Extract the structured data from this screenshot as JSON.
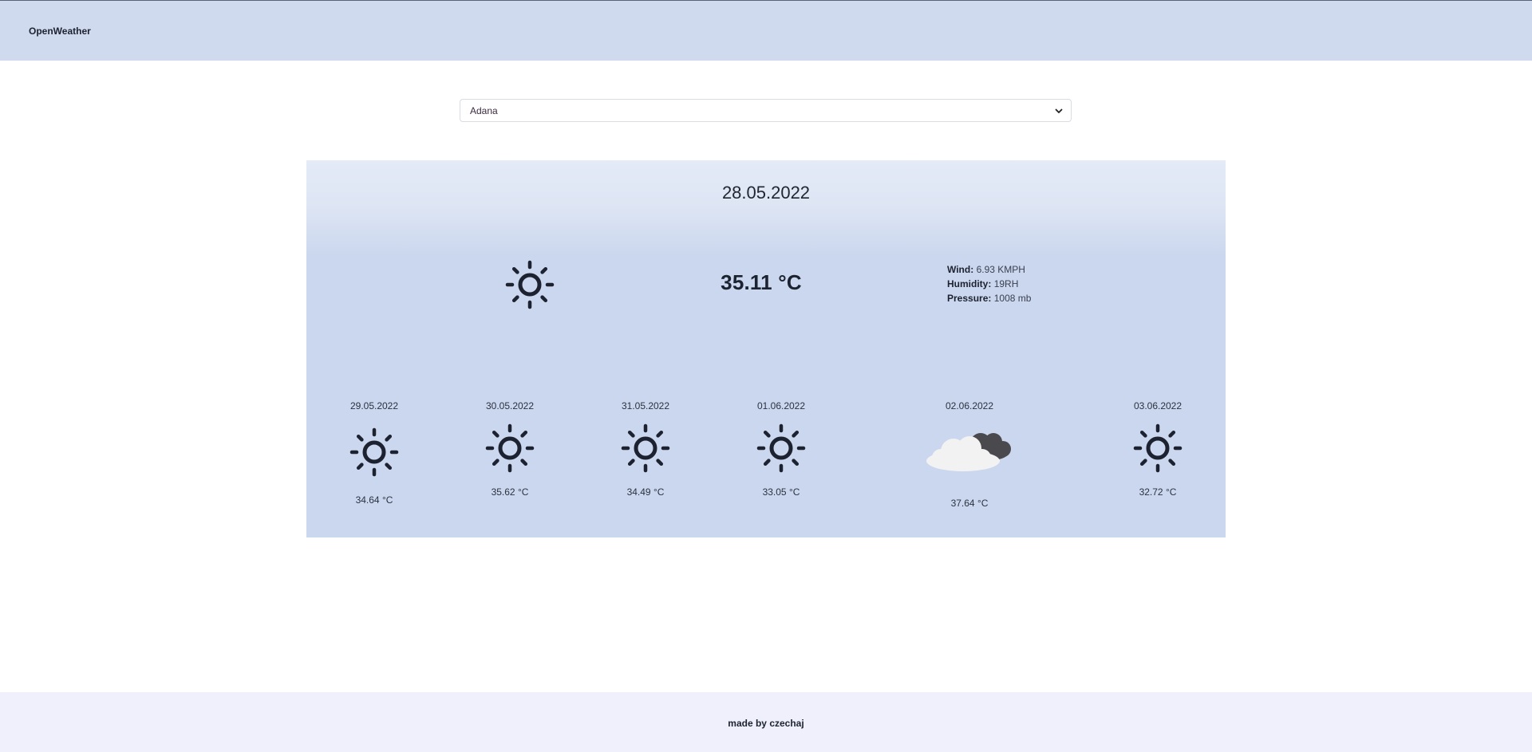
{
  "navbar": {
    "brand": "OpenWeather"
  },
  "city_select": {
    "selected": "Adana"
  },
  "current": {
    "date": "28.05.2022",
    "icon": "sun-icon",
    "temperature": "35.11 °C",
    "wind_label": "Wind:",
    "wind_value": "6.93 KMPH",
    "humidity_label": "Humidity:",
    "humidity_value": "19RH",
    "pressure_label": "Pressure:",
    "pressure_value": "1008 mb"
  },
  "forecast": [
    {
      "date": "29.05.2022",
      "icon": "sun-icon",
      "temperature": "34.64 °C"
    },
    {
      "date": "30.05.2022",
      "icon": "sun-icon",
      "temperature": "35.62 °C"
    },
    {
      "date": "31.05.2022",
      "icon": "sun-icon",
      "temperature": "34.49 °C"
    },
    {
      "date": "01.06.2022",
      "icon": "sun-icon",
      "temperature": "33.05 °C"
    },
    {
      "date": "02.06.2022",
      "icon": "cloud-icon",
      "temperature": "37.64 °C"
    },
    {
      "date": "03.06.2022",
      "icon": "sun-icon",
      "temperature": "32.72 °C"
    }
  ],
  "footer": {
    "text": "made by czechaj"
  },
  "colors": {
    "navbar_bg": "#cfdaee",
    "card_bg": "#cbd7ee",
    "footer_bg": "#eff0fb",
    "icon_color": "#1c2230"
  }
}
